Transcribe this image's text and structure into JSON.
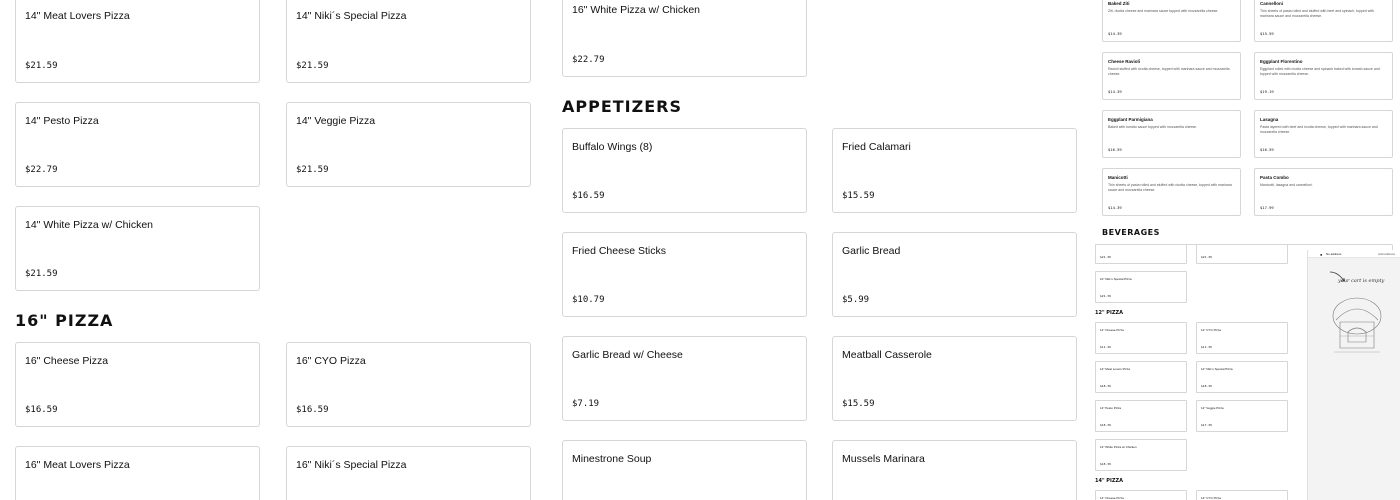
{
  "left_cards": [
    {
      "name": "14\" Meat Lovers Pizza",
      "price": "$21.59"
    },
    {
      "name": "14\" Niki´s Special Pizza",
      "price": "$21.59"
    },
    {
      "name": "14\" Pesto Pizza",
      "price": "$22.79"
    },
    {
      "name": "14\" Veggie Pizza",
      "price": "$21.59"
    },
    {
      "name": "14\" White Pizza w/ Chicken",
      "price": "$21.59"
    }
  ],
  "section_16": {
    "title": "16\" PIZZA"
  },
  "cards_16": [
    {
      "name": "16\" Cheese Pizza",
      "price": "$16.59"
    },
    {
      "name": "16\" CYO Pizza",
      "price": "$16.59"
    },
    {
      "name": "16\" Meat Lovers Pizza",
      "price": ""
    },
    {
      "name": "16\" Niki´s Special Pizza",
      "price": ""
    }
  ],
  "middle_top_card": {
    "name": "16\" White Pizza w/ Chicken",
    "price": "$22.79"
  },
  "appetizers": {
    "title": "APPETIZERS",
    "items": [
      {
        "name": "Buffalo Wings (8)",
        "price": "$16.59"
      },
      {
        "name": "Fried Calamari",
        "price": "$15.59"
      },
      {
        "name": "Fried Cheese Sticks",
        "price": "$10.79"
      },
      {
        "name": "Garlic Bread",
        "price": "$5.99"
      },
      {
        "name": "Garlic Bread w/ Cheese",
        "price": "$7.19"
      },
      {
        "name": "Meatball Casserole",
        "price": "$15.59"
      },
      {
        "name": "Minestrone Soup",
        "price": ""
      },
      {
        "name": "Mussels Marinara",
        "price": ""
      }
    ]
  },
  "pasta_mini": [
    {
      "name": "Baked Ziti",
      "desc": "Ziti, ricotta cheese and marinara sauce topped with mozzarella cheese.",
      "price": "$14.39"
    },
    {
      "name": "Cannelloni",
      "desc": "Thin sheets of pasta rolled and stuffed with beef and spinach, topped with marinara sauce and mozzarella cheese.",
      "price": "$15.59"
    },
    {
      "name": "Cheese Ravioli",
      "desc": "Ravioli stuffed with ricotta cheese, topped with marinara sauce and mozzarella cheese.",
      "price": "$14.39"
    },
    {
      "name": "Eggplant Florentino",
      "desc": "Eggplant rolled with ricotta cheese and spinach baked with tomato sauce and topped with mozzarella cheese.",
      "price": "$19.19"
    },
    {
      "name": "Eggplant Parmigiana",
      "desc": "Baked with tomato sauce topped with mozzarella cheese.",
      "price": "$16.59"
    },
    {
      "name": "Lasagna",
      "desc": "Pasta layered with beef and ricotta cheese, topped with marinara sauce and mozzarella cheese.",
      "price": "$16.59"
    },
    {
      "name": "Manicotti",
      "desc": "Thin sheets of pasta rolled and stuffed with ricotta cheese, topped with marinara sauce and mozzarella cheese.",
      "price": "$14.39"
    },
    {
      "name": "Pasta Combo",
      "desc": "Manicotti, lasagna and cannelloni.",
      "price": "$17.99"
    }
  ],
  "beverages": {
    "title": "BEVERAGES"
  },
  "tiny_panel": {
    "top_cards": [
      {
        "name": "",
        "price": "$21.39"
      },
      {
        "name": "",
        "price": "$21.39"
      },
      {
        "name": "10\" Niki´s Special Pizza",
        "price": "$21.39"
      }
    ],
    "section_12": "12\" PIZZA",
    "cards_12": [
      {
        "name": "12\" Cheese Pizza",
        "price": "$11.39"
      },
      {
        "name": "12\" CYO Pizza",
        "price": "$11.39"
      },
      {
        "name": "12\" Meat Lovers Pizza",
        "price": "$18.39"
      },
      {
        "name": "12\" Niki´s Special Pizza",
        "price": "$18.39"
      },
      {
        "name": "12\" Pesto Pizza",
        "price": "$18.39"
      },
      {
        "name": "12\" Veggie Pizza",
        "price": "$17.39"
      },
      {
        "name": "12\" White Pizza w/ Chicken",
        "price": "$18.39"
      }
    ],
    "section_14": "14\" PIZZA",
    "cards_14": [
      {
        "name": "14\" Cheese Pizza",
        "price": ""
      },
      {
        "name": "14\" CYO Pizza",
        "price": ""
      }
    ]
  },
  "cart": {
    "address": "No address",
    "signin": "Add address",
    "empty_text": "your cart is empty",
    "pin_icon": "map-pin-icon",
    "illustration_icon": "pizza-oven-icon"
  }
}
